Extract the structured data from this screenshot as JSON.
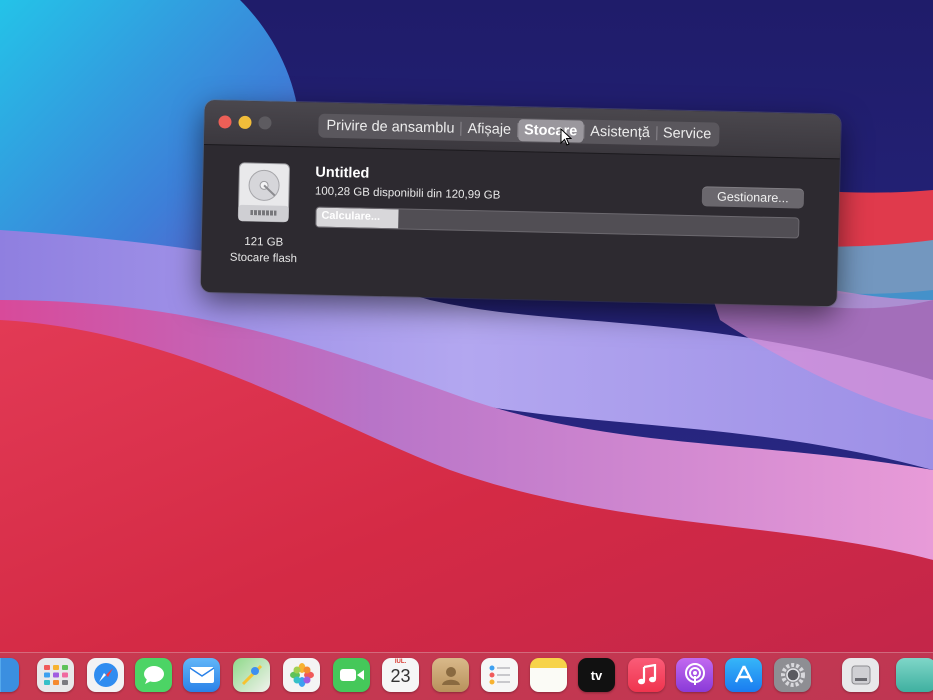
{
  "window": {
    "tabs": [
      {
        "label": "Privire de ansamblu",
        "selected": false
      },
      {
        "label": "Afișaje",
        "selected": false
      },
      {
        "label": "Stocare",
        "selected": true
      },
      {
        "label": "Asistență",
        "selected": false
      },
      {
        "label": "Service",
        "selected": false
      }
    ],
    "disk": {
      "size": "121 GB",
      "type": "Stocare flash"
    },
    "volume": {
      "name": "Untitled",
      "available": "100,28 GB disponibili din 120,99 GB",
      "manage_label": "Gestionare...",
      "bar_label": "Calculare...",
      "progress": 0.17
    }
  },
  "dock": {
    "calendar": {
      "month": "IUL.",
      "day": "23"
    },
    "tv_label": "tv",
    "items": [
      "finder-icon",
      "launchpad-icon",
      "safari-icon",
      "messages-icon",
      "mail-icon",
      "maps-icon",
      "photos-icon",
      "facetime-icon",
      "calendar-icon",
      "contacts-icon",
      "reminders-icon",
      "notes-icon",
      "tv-icon",
      "music-icon",
      "podcasts-icon",
      "app-store-icon",
      "system-preferences-icon",
      "disk-utility-icon",
      "trash-icon"
    ]
  },
  "colors": {
    "close": "#ec5f57",
    "minimize": "#f1bd3a",
    "window_bg": "#2d2a30"
  }
}
